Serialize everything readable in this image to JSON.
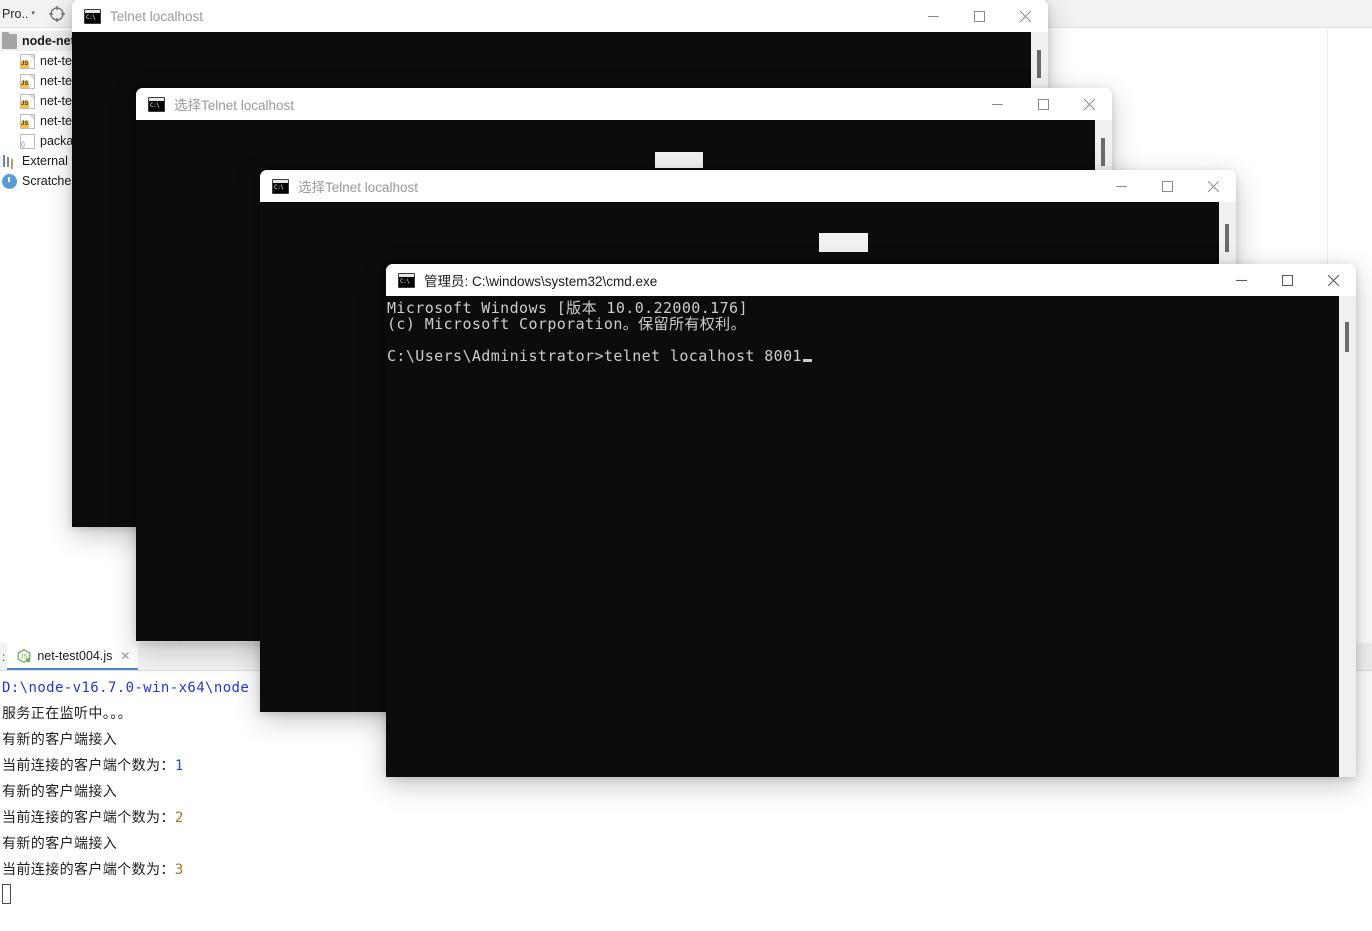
{
  "ide": {
    "toolbar": {
      "project_label": "Pro..",
      "caret": "▾",
      "locate_icon": "crosshair-icon"
    },
    "sidebar": {
      "items": [
        {
          "label": "node-net",
          "icon": "folder-icon",
          "type": "root"
        },
        {
          "label": "net-test",
          "icon": "js-file-icon",
          "type": "file"
        },
        {
          "label": "net-test",
          "icon": "js-file-icon",
          "type": "file"
        },
        {
          "label": "net-test",
          "icon": "js-file-icon",
          "type": "file"
        },
        {
          "label": "net-test",
          "icon": "js-file-icon",
          "type": "file"
        },
        {
          "label": "packag",
          "icon": "json-file-icon",
          "type": "file"
        },
        {
          "label": "External Li",
          "icon": "library-icon",
          "type": "node"
        },
        {
          "label": "Scratches",
          "icon": "clock-icon",
          "type": "node"
        }
      ]
    },
    "run_panel": {
      "left_label": ":",
      "tab": {
        "label": "net-test004.js",
        "icon": "nodejs-icon",
        "close": "✕"
      },
      "console_lines": [
        {
          "text": "D:\\node-v16.7.0-win-x64\\node",
          "style": "blue"
        },
        {
          "text": "服务正在监听中。。。",
          "style": "plain"
        },
        {
          "text": "有新的客户端接入",
          "style": "plain"
        },
        {
          "text": "当前连接的客户端个数为：",
          "value": "1",
          "style": "count"
        },
        {
          "text": "有新的客户端接入",
          "style": "plain"
        },
        {
          "text": "当前连接的客户端个数为：",
          "value": "2",
          "style": "count"
        },
        {
          "text": "有新的客户端接入",
          "style": "plain"
        },
        {
          "text": "当前连接的客户端个数为：",
          "value": "3",
          "style": "count"
        },
        {
          "text": "",
          "style": "caret"
        }
      ]
    }
  },
  "windows": [
    {
      "id": "telnet-1",
      "title": "Telnet localhost",
      "icon": "cmd-icon",
      "active": false,
      "controls": {
        "minimize": "−",
        "maximize": "▢",
        "close": "✕"
      },
      "terminal_lines": []
    },
    {
      "id": "telnet-2",
      "title": "选择Telnet localhost",
      "icon": "cmd-icon",
      "active": false,
      "controls": {
        "minimize": "−",
        "maximize": "▢",
        "close": "✕"
      },
      "terminal_lines": []
    },
    {
      "id": "telnet-3",
      "title": "选择Telnet localhost",
      "icon": "cmd-icon",
      "active": false,
      "controls": {
        "minimize": "−",
        "maximize": "▢",
        "close": "✕"
      },
      "terminal_lines": []
    },
    {
      "id": "cmd-admin",
      "title": "管理员: C:\\windows\\system32\\cmd.exe",
      "icon": "cmd-icon",
      "active": true,
      "controls": {
        "minimize": "−",
        "maximize": "▢",
        "close": "✕"
      },
      "terminal_lines": [
        "Microsoft Windows [版本 10.0.22000.176]",
        "(c) Microsoft Corporation。保留所有权利。",
        "",
        "C:\\Users\\Administrator>telnet localhost 8001"
      ]
    }
  ]
}
